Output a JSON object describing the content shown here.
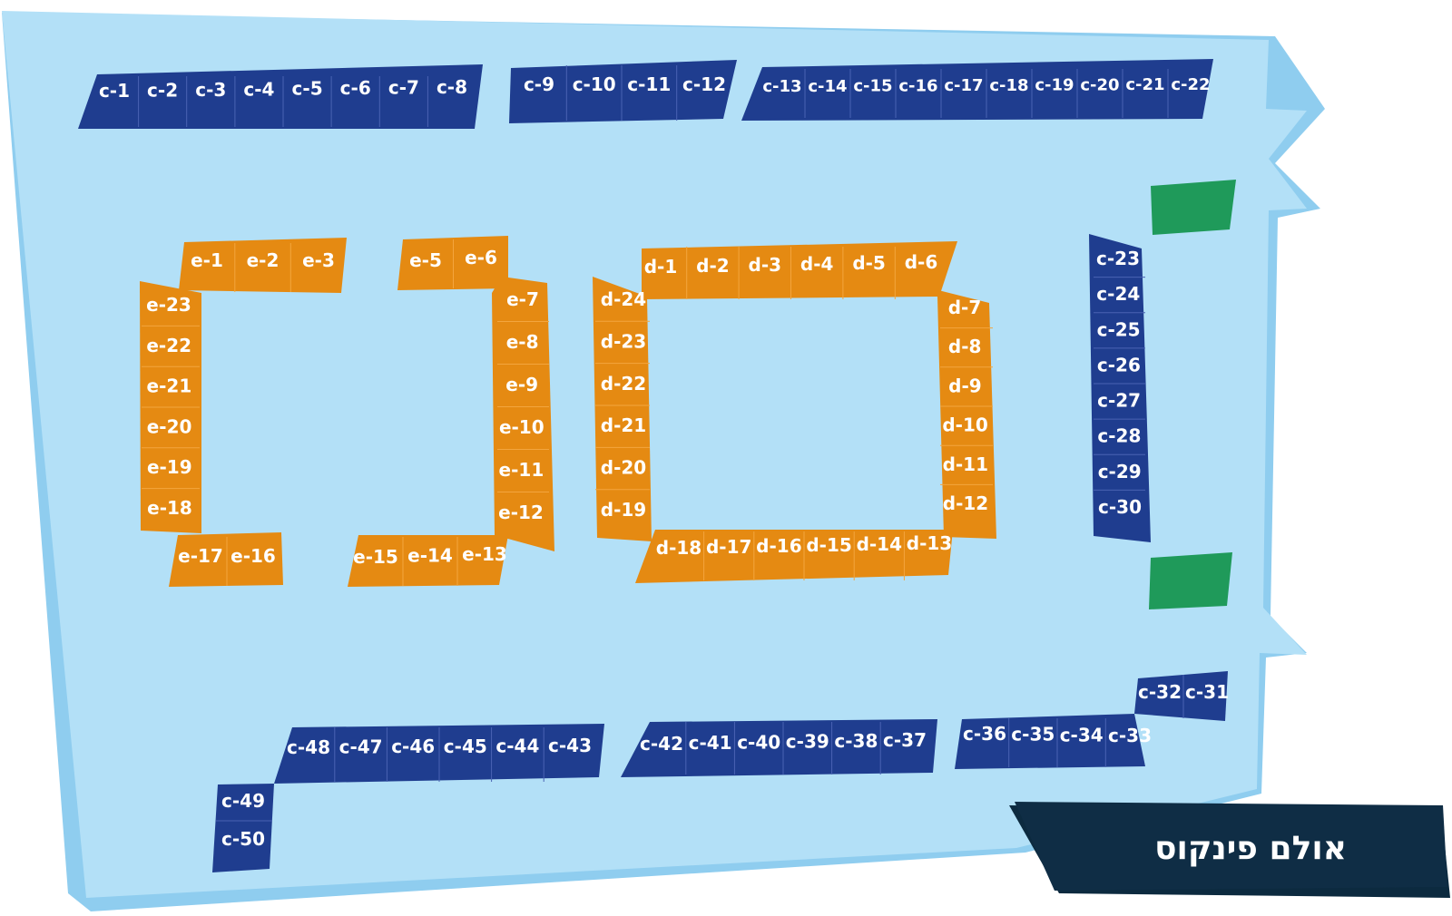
{
  "hall_title": "אולם פינקוס",
  "colors": {
    "floor": "#b3e0f7",
    "floor_edge": "#8fcdef",
    "blue_booth": "#1f3d8f",
    "orange_booth": "#e58a12",
    "green_marker": "#1f9a5a",
    "title_bg": "#0f2d45"
  },
  "rows": {
    "c_top_a": [
      "c-1",
      "c-2",
      "c-3",
      "c-4",
      "c-5",
      "c-6",
      "c-7",
      "c-8"
    ],
    "c_top_b": [
      "c-9",
      "c-10",
      "c-11",
      "c-12"
    ],
    "c_top_c": [
      "c-13",
      "c-14",
      "c-15",
      "c-16",
      "c-17",
      "c-18",
      "c-19",
      "c-20",
      "c-21",
      "c-22"
    ],
    "c_right": [
      "c-23",
      "c-24",
      "c-25",
      "c-26",
      "c-27",
      "c-28",
      "c-29",
      "c-30"
    ],
    "c_br_top": [
      "c-32",
      "c-31"
    ],
    "c_br_bottom": [
      "c-36",
      "c-35",
      "c-34",
      "c-33"
    ],
    "c_bottom_mid": [
      "c-42",
      "c-41",
      "c-40",
      "c-39",
      "c-38",
      "c-37"
    ],
    "c_bottom_left": [
      "c-48",
      "c-47",
      "c-46",
      "c-45",
      "c-44",
      "c-43"
    ],
    "c_bottom_left_col": [
      "c-49",
      "c-50"
    ],
    "e_top_left": [
      "e-1",
      "e-2",
      "e-3"
    ],
    "e_left_col": [
      "e-23",
      "e-22",
      "e-21",
      "e-20",
      "e-19",
      "e-18"
    ],
    "e_bottom_left": [
      "e-17",
      "e-16"
    ],
    "e_top_right": [
      "e-5",
      "e-6"
    ],
    "e_right_col": [
      "e-7",
      "e-8",
      "e-9",
      "e-10",
      "e-11",
      "e-12"
    ],
    "e_bottom_right": [
      "e-15",
      "e-14",
      "e-13"
    ],
    "d_top": [
      "d-1",
      "d-2",
      "d-3",
      "d-4",
      "d-5",
      "d-6"
    ],
    "d_left": [
      "d-24",
      "d-23",
      "d-22",
      "d-21",
      "d-20",
      "d-19"
    ],
    "d_right": [
      "d-7",
      "d-8",
      "d-9",
      "d-10",
      "d-11",
      "d-12"
    ],
    "d_bottom": [
      "d-18",
      "d-17",
      "d-16",
      "d-15",
      "d-14",
      "d-13"
    ]
  }
}
